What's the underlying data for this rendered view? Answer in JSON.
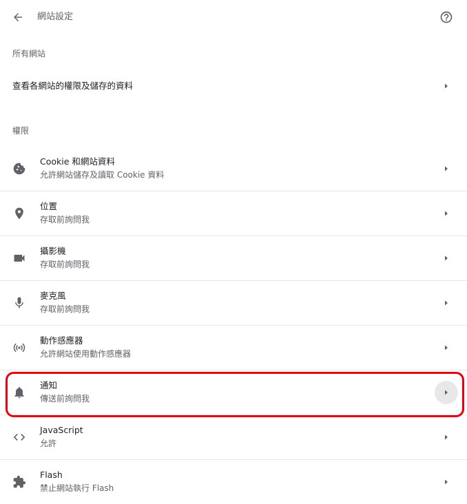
{
  "header": {
    "title": "網站設定"
  },
  "all_sites": {
    "section_title": "所有網站",
    "row_label": "查看各網站的權限及儲存的資料"
  },
  "permissions": {
    "section_title": "權限",
    "items": [
      {
        "label": "Cookie 和網站資料",
        "sublabel": "允許網站儲存及讀取 Cookie 資料",
        "icon": "cookie-icon"
      },
      {
        "label": "位置",
        "sublabel": "存取前詢問我",
        "icon": "location-pin-icon"
      },
      {
        "label": "攝影機",
        "sublabel": "存取前詢問我",
        "icon": "video-camera-icon"
      },
      {
        "label": "麥克風",
        "sublabel": "存取前詢問我",
        "icon": "microphone-icon"
      },
      {
        "label": "動作感應器",
        "sublabel": "允許網站使用動作感應器",
        "icon": "sensors-icon"
      },
      {
        "label": "通知",
        "sublabel": "傳送前詢問我",
        "icon": "bell-icon"
      },
      {
        "label": "JavaScript",
        "sublabel": "允許",
        "icon": "code-icon"
      },
      {
        "label": "Flash",
        "sublabel": "禁止網站執行 Flash",
        "icon": "puzzle-icon"
      }
    ]
  },
  "colors": {
    "icon": "#5f6368",
    "highlight": "#e5000f"
  }
}
